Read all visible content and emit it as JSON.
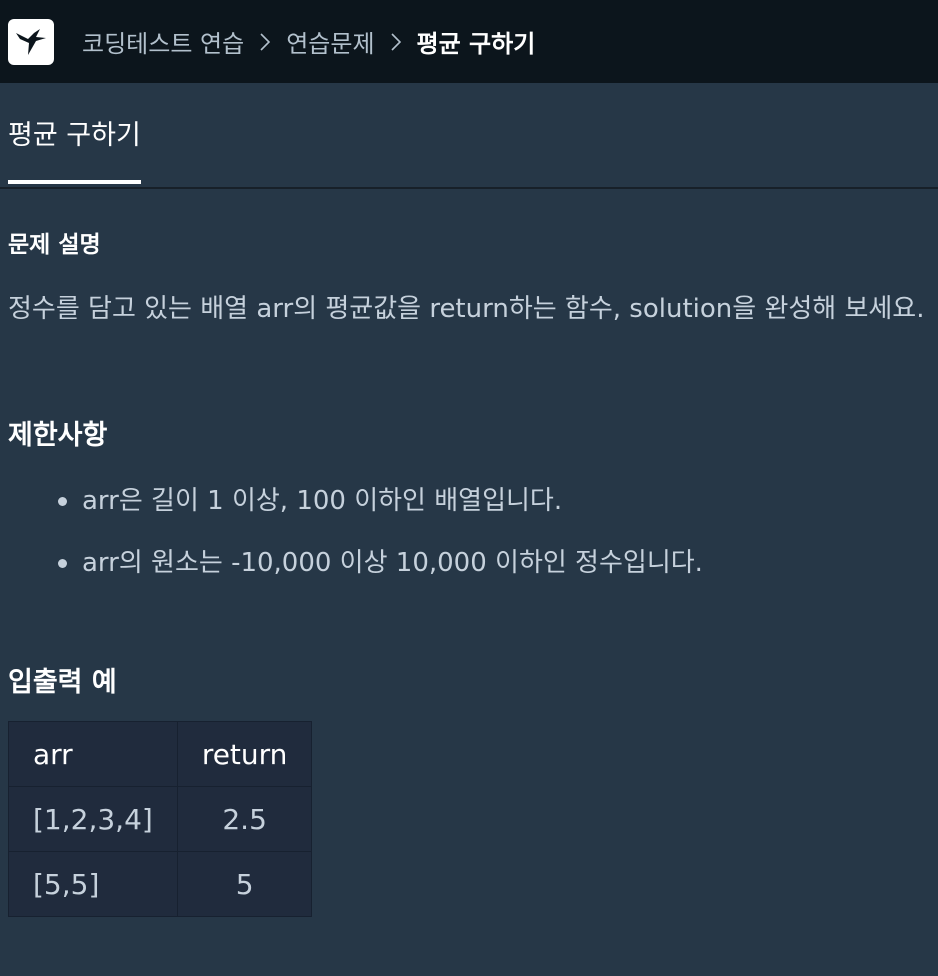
{
  "breadcrumb": {
    "items": [
      "코딩테스트 연습",
      "연습문제"
    ],
    "current": "평균 구하기"
  },
  "tab": {
    "label": "평균 구하기"
  },
  "description": {
    "heading": "문제 설명",
    "text": "정수를 담고 있는 배열 arr의 평균값을 return하는 함수, solution을 완성해 보세요."
  },
  "limits": {
    "heading": "제한사항",
    "items": [
      "arr은 길이 1 이상, 100 이하인 배열입니다.",
      "arr의 원소는 -10,000 이상 10,000 이하인 정수입니다."
    ]
  },
  "examples": {
    "heading": "입출력 예",
    "columns": [
      "arr",
      "return"
    ],
    "rows": [
      [
        "[1,2,3,4]",
        "2.5"
      ],
      [
        "[5,5]",
        "5"
      ]
    ]
  },
  "icons": {
    "logo": "hummingbird-logo-icon",
    "separator": "chevron-right-icon"
  },
  "colors": {
    "topbar": "#0c151c",
    "background": "#263747",
    "table": "#202b3d"
  }
}
